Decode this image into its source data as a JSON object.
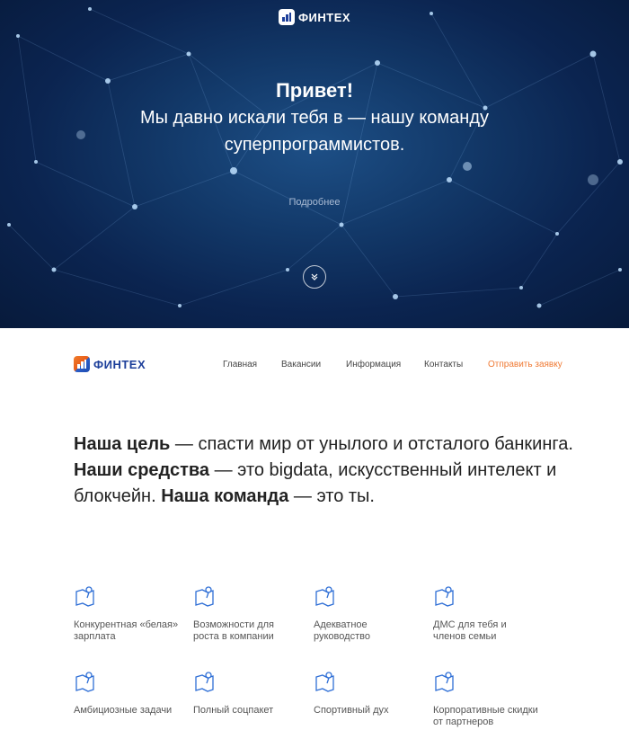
{
  "hero": {
    "brand": "ФИНТЕХ",
    "logo_icon": "fintech-logo-icon",
    "greeting": "Привет!",
    "subtitle_line1": "Мы давно искали тебя в — нашу команду",
    "subtitle_line2": "суперпрограммистов.",
    "more_label": "Подробнее",
    "scroll_icon": "chevron-double-down-icon"
  },
  "nav": {
    "brand": "ФИНТЕХ",
    "links": [
      {
        "label": "Главная"
      },
      {
        "label": "Вакансии"
      },
      {
        "label": "Информация"
      },
      {
        "label": "Контакты"
      }
    ],
    "cta_label": "Отправить заявку"
  },
  "mission": {
    "goal_strong": "Наша цель",
    "goal_rest": " — спасти мир от унылого и отсталого банкинга.",
    "means_strong": "Наши средства",
    "means_rest": " — это bigdata, искусственный интелект и блокчейн. ",
    "team_strong": "Наша команда",
    "team_rest": " — это ты."
  },
  "benefits": [
    {
      "label": "Конкурентная «белая» зарплата",
      "icon": "map-pin-icon"
    },
    {
      "label": "Возможности для роста в компании",
      "icon": "map-pin-icon"
    },
    {
      "label": "Адекватное руководство",
      "icon": "map-pin-icon"
    },
    {
      "label": "ДМС для тебя и членов семьи",
      "icon": "map-pin-icon"
    },
    {
      "label": "Амбициозные задачи",
      "icon": "map-pin-icon"
    },
    {
      "label": "Полный соцпакет",
      "icon": "map-pin-icon"
    },
    {
      "label": "Спортивный дух",
      "icon": "map-pin-icon"
    },
    {
      "label": "Корпоративные скидки от партнеров",
      "icon": "map-pin-icon"
    }
  ],
  "colors": {
    "accent": "#f07a34",
    "brand_blue": "#1d3f9a",
    "icon_blue": "#2f6fd6",
    "hero_bg": "#0b2450"
  }
}
